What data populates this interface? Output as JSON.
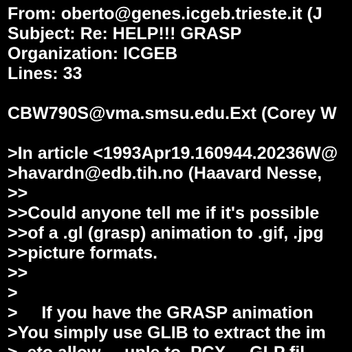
{
  "message": {
    "lines": [
      "From: oberto@genes.icgeb.trieste.it (J",
      "Subject: Re: HELP!!! GRASP",
      "Organization: ICGEB",
      "Lines: 33",
      "",
      "CBW790S@vma.smsu.edu.Ext (Corey W",
      "",
      ">In article <1993Apr19.160944.20236W@",
      ">havardn@edb.tih.no (Haavard Nesse,",
      ">>",
      ">>Could anyone tell me if it's possible",
      ">>of a .gl (grasp) animation to .gif, .jpg",
      ">>picture formats.",
      ">>",
      ">",
      ">     If you have the GRASP animation",
      ">You simply use GLIB to extract the im",
      ">  eto allow ... uple to .PCX ... GLP fil"
    ]
  },
  "colors": {
    "background": "#000000",
    "text": "#ffffff"
  }
}
